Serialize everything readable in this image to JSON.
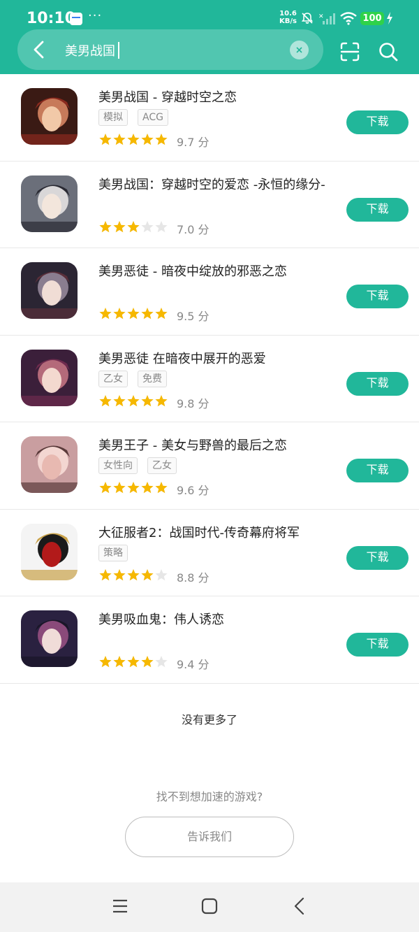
{
  "status": {
    "time": "10:10",
    "speed_value": "10.6",
    "speed_unit": "KB/s",
    "battery": "100"
  },
  "search": {
    "query": "美男战国"
  },
  "games": [
    {
      "title": "美男战国 - 穿越时空之恋",
      "tags": [
        "模拟",
        "ACG"
      ],
      "rating": 5,
      "score": "9.7 分",
      "button": "下载",
      "icon": "romance-couple-art"
    },
    {
      "title": "美男战国：穿越时空的爱恋 -永恒的缘分-",
      "tags": [],
      "rating": 3.5,
      "score": "7.0 分",
      "button": "下载",
      "icon": "silver-hair-man-art"
    },
    {
      "title": "美男恶徒 - 暗夜中绽放的邪恶之恋",
      "tags": [],
      "rating": 5,
      "score": "9.5 分",
      "button": "下载",
      "icon": "dark-hair-man-art"
    },
    {
      "title": "美男恶徒 在暗夜中展开的恶爱",
      "tags": [
        "乙女",
        "免费"
      ],
      "rating": 5,
      "score": "9.8 分",
      "button": "下载",
      "icon": "villain-man-art"
    },
    {
      "title": "美男王子 - 美女与野兽的最后之恋",
      "tags": [
        "女性向",
        "乙女"
      ],
      "rating": 5,
      "score": "9.6 分",
      "button": "下载",
      "icon": "prince-couple-art"
    },
    {
      "title": "大征服者2：战国时代-传奇幕府将军",
      "tags": [
        "策略"
      ],
      "rating": 4.5,
      "score": "8.8 分",
      "button": "下载",
      "icon": "samurai-helmet-art"
    },
    {
      "title": "美男吸血鬼：伟人诱恋",
      "tags": [],
      "rating": 4.5,
      "score": "9.4 分",
      "button": "下载",
      "icon": "vampire-man-art"
    }
  ],
  "footer": {
    "no_more": "没有更多了",
    "cant_find": "找不到想加速的游戏?",
    "tell_us": "告诉我们"
  },
  "colors": {
    "primary": "#21b79a",
    "star": "#f6b800",
    "star_empty": "#e6e6e6"
  }
}
